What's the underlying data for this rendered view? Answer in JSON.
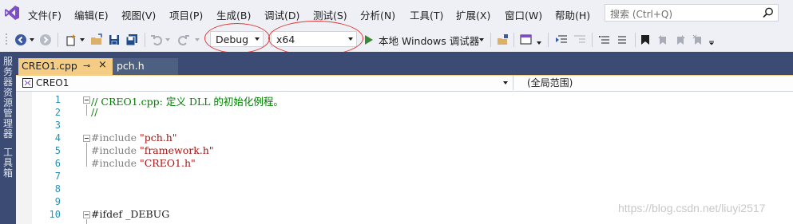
{
  "menubar": {
    "logo": "visual-studio-logo-icon",
    "items": [
      "文件(F)",
      "编辑(E)",
      "视图(V)",
      "项目(P)",
      "生成(B)",
      "调试(D)",
      "测试(S)",
      "分析(N)",
      "工具(T)",
      "扩展(X)",
      "窗口(W)",
      "帮助(H)"
    ],
    "search_placeholder": "搜索 (Ctrl+Q)"
  },
  "toolbar": {
    "config": "Debug",
    "platform": "x64",
    "run_label": "本地 Windows 调试器",
    "highlight_color": "#e03a3a"
  },
  "left_rail": {
    "items": [
      "服务器资源管理器",
      "工具箱"
    ]
  },
  "tabs": [
    {
      "label": "CREO1.cpp",
      "pin": "⊸",
      "close": "×",
      "active": true
    },
    {
      "label": "pch.h",
      "active": false
    }
  ],
  "navbar": {
    "file": "CREO1",
    "scope": "(全局范围)"
  },
  "code_lines": [
    {
      "n": "1",
      "text": "// CREO1.cpp: 定义 DLL 的初始化例程。"
    },
    {
      "n": "2",
      "text": "//"
    },
    {
      "n": "3",
      "text": ""
    },
    {
      "n": "4",
      "pre": "#include ",
      "str": "\"pch.h\""
    },
    {
      "n": "5",
      "pre": "#include ",
      "str": "\"framework.h\""
    },
    {
      "n": "6",
      "pre": "#include ",
      "str": "\"CREO1.h\""
    },
    {
      "n": "7",
      "text": ""
    },
    {
      "n": "8",
      "text": ""
    },
    {
      "n": "9",
      "text": ""
    },
    {
      "n": "10",
      "text": "#ifdef _DEBUG"
    }
  ],
  "watermark": "https://blog.csdn.net/liuyi2517"
}
